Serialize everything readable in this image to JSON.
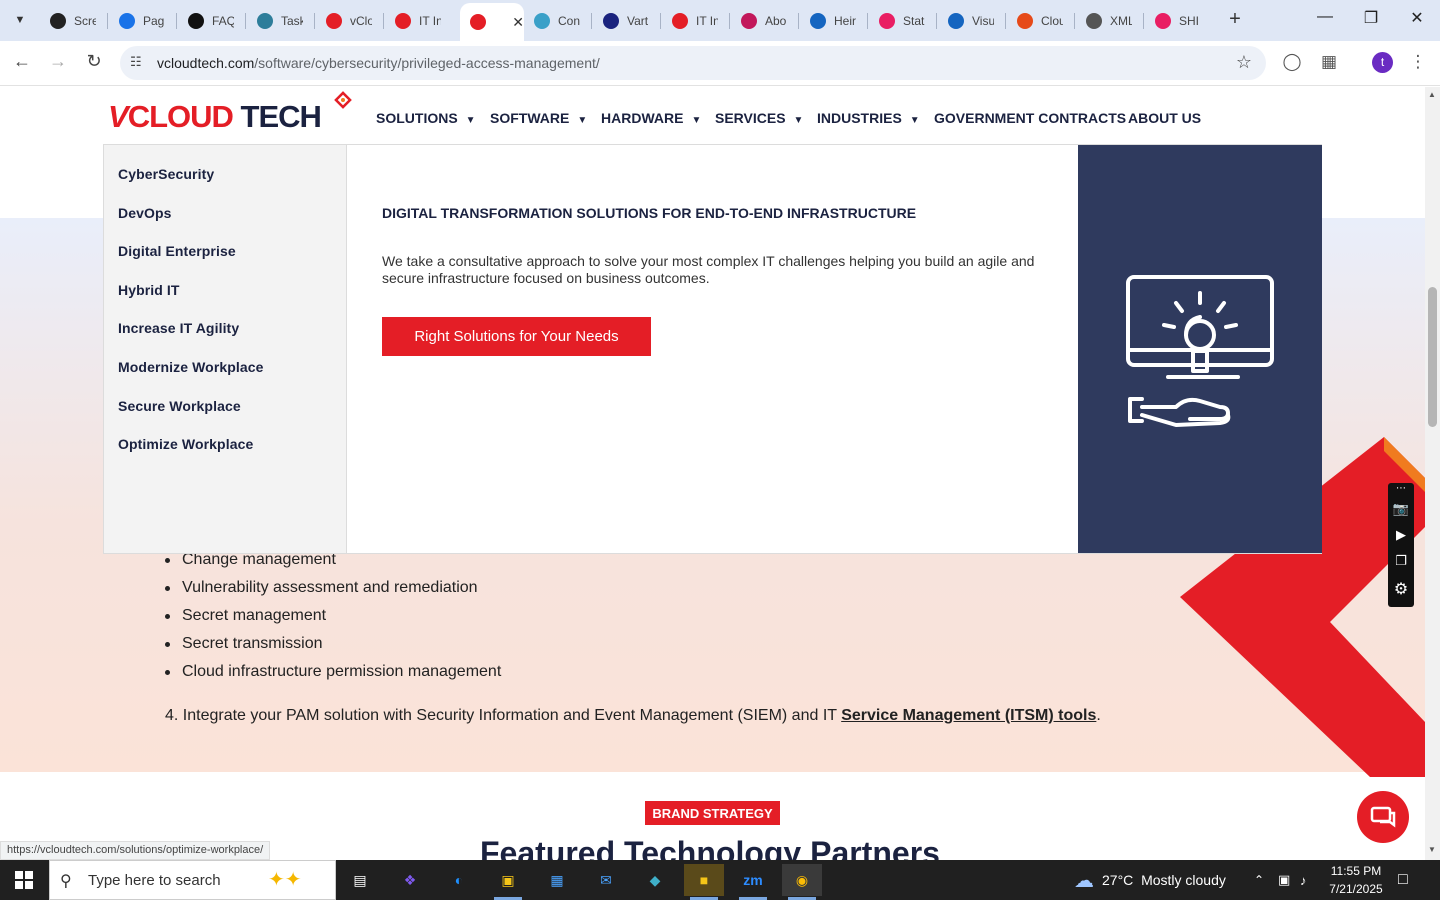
{
  "browser": {
    "tabs": [
      {
        "label": "Scre",
        "icon": "screencast-icon",
        "color": "#222222"
      },
      {
        "label": "Pag",
        "icon": "pagespeed-icon",
        "color": "#1a73e8"
      },
      {
        "label": "FAQ",
        "icon": "faq-icon",
        "color": "#111111"
      },
      {
        "label": "Task",
        "icon": "task-icon",
        "color": "#2d7d9a"
      },
      {
        "label": "vClo",
        "icon": "vcloud-icon",
        "color": "#e41e26"
      },
      {
        "label": "IT In",
        "icon": "it-icon",
        "color": "#e41e26"
      },
      {
        "label": "",
        "icon": "active-site-icon",
        "color": "#e41e26"
      },
      {
        "label": "Con",
        "icon": "con-icon",
        "color": "#3aa0c8"
      },
      {
        "label": "Vart",
        "icon": "x-icon",
        "color": "#1a237e"
      },
      {
        "label": "IT In",
        "icon": "it-icon",
        "color": "#e41e26"
      },
      {
        "label": "Abo",
        "icon": "about-icon",
        "color": "#c2185b"
      },
      {
        "label": "Heir",
        "icon": "scale-icon",
        "color": "#1565c0"
      },
      {
        "label": "Stat",
        "icon": "stat-icon",
        "color": "#e91e63"
      },
      {
        "label": "Visu",
        "icon": "pulse-icon",
        "color": "#1565c0"
      },
      {
        "label": "Clou",
        "icon": "cloud-icon",
        "color": "#e64a19"
      },
      {
        "label": "XML",
        "icon": "globe-icon",
        "color": "#555555"
      },
      {
        "label": "SHI",
        "icon": "shi-icon",
        "color": "#e91e63"
      }
    ],
    "url_domain": "vcloudtech.com",
    "url_path": "/software/cybersecurity/privileged-access-management/",
    "profile_initial": "t",
    "status_url": "https://vcloudtech.com/solutions/optimize-workplace/"
  },
  "site": {
    "logo_v": "V",
    "logo_cloud": "CLOUD",
    "logo_tech": " TECH",
    "nav": [
      {
        "label": "SOLUTIONS",
        "dropdown": true
      },
      {
        "label": "SOFTWARE",
        "dropdown": true
      },
      {
        "label": "HARDWARE",
        "dropdown": true
      },
      {
        "label": "SERVICES",
        "dropdown": true
      },
      {
        "label": "INDUSTRIES",
        "dropdown": true
      },
      {
        "label": "GOVERNMENT CONTRACTS",
        "dropdown": false
      },
      {
        "label": "ABOUT US",
        "dropdown": false
      }
    ],
    "mega_menu": {
      "items": [
        "CyberSecurity",
        "DevOps",
        "Digital Enterprise",
        "Hybrid IT",
        "Increase IT Agility",
        "Modernize Workplace",
        "Secure Workplace",
        "Optimize Workplace"
      ],
      "title": "DIGITAL TRANSFORMATION SOLUTIONS FOR END-TO-END INFRASTRUCTURE",
      "description": "We take a consultative approach to solve your most complex IT challenges helping you build an agile and secure infrastructure focused on business outcomes.",
      "cta": "Right Solutions for Your Needs",
      "panel_icon": "monitor-lightbulb-hand-icon"
    },
    "bullets": [
      "Change management",
      "Vulnerability assessment and remediation",
      "Secret management",
      "Secret transmission",
      "Cloud infrastructure permission management"
    ],
    "step4_number": "4.",
    "step4_text": "Integrate your PAM solution with Security Information and Event Management (SIEM) and IT ",
    "step4_link": "Service Management (ITSM) tools",
    "step4_end": ".",
    "brand_badge": "BRAND STRATEGY",
    "partners_title": "Featured Technology Partners",
    "colors": {
      "brand_red": "#e41e26",
      "navy": "#1b2240",
      "panel": "#2f3a5e"
    }
  },
  "taskbar": {
    "search_placeholder": "Type here to search",
    "weather_temp": "27°C",
    "weather_text": "Mostly cloudy",
    "time": "11:55 PM",
    "date": "7/21/2025"
  }
}
